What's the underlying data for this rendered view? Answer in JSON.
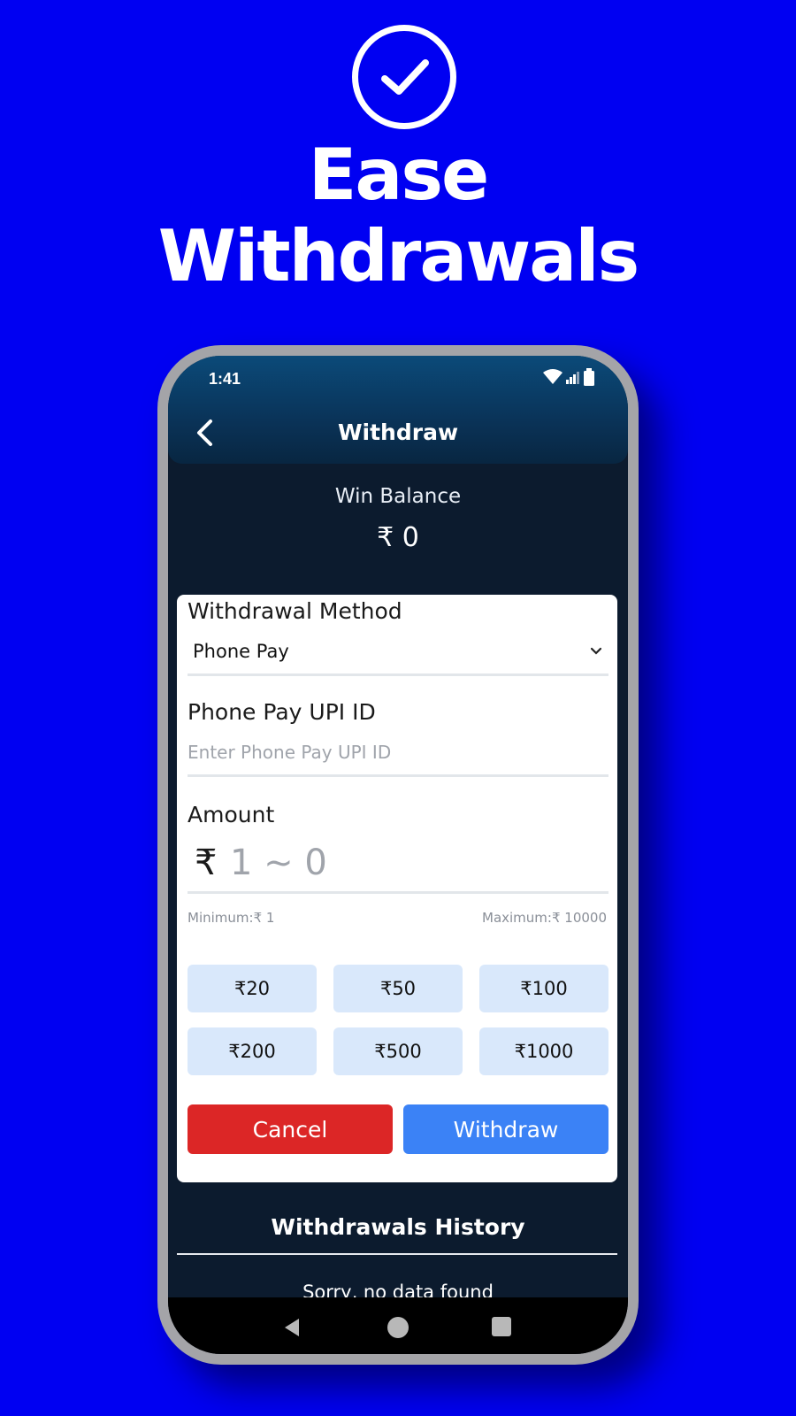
{
  "hero": {
    "title_line1": "Ease",
    "title_line2": "Withdrawals",
    "icon": "check-circle-icon",
    "background_color": "#0000f2"
  },
  "status_bar": {
    "time": "1:41",
    "icons": [
      "wifi-icon",
      "signal-icon",
      "battery-icon"
    ]
  },
  "header": {
    "title": "Withdraw",
    "back_icon": "chevron-left-icon"
  },
  "balance": {
    "label": "Win Balance",
    "value": "₹ 0"
  },
  "form": {
    "method_label": "Withdrawal Method",
    "method_value": "Phone Pay",
    "upi_label": "Phone Pay UPI ID",
    "upi_placeholder": "Enter Phone Pay UPI ID",
    "amount_label": "Amount",
    "currency_symbol": "₹",
    "amount_placeholder": "1 ~ 0",
    "minimum": "Minimum:₹ 1",
    "maximum": "Maximum:₹ 10000",
    "quick_amounts": [
      "₹20",
      "₹50",
      "₹100",
      "₹200",
      "₹500",
      "₹1000"
    ],
    "cancel_label": "Cancel",
    "withdraw_label": "Withdraw",
    "cancel_color": "#dc2626",
    "withdraw_color": "#3b82f6"
  },
  "history": {
    "title": "Withdrawals History",
    "empty_text": "Sorry, no data found"
  },
  "nav": {
    "icons": [
      "nav-back-icon",
      "nav-home-icon",
      "nav-recents-icon"
    ]
  }
}
